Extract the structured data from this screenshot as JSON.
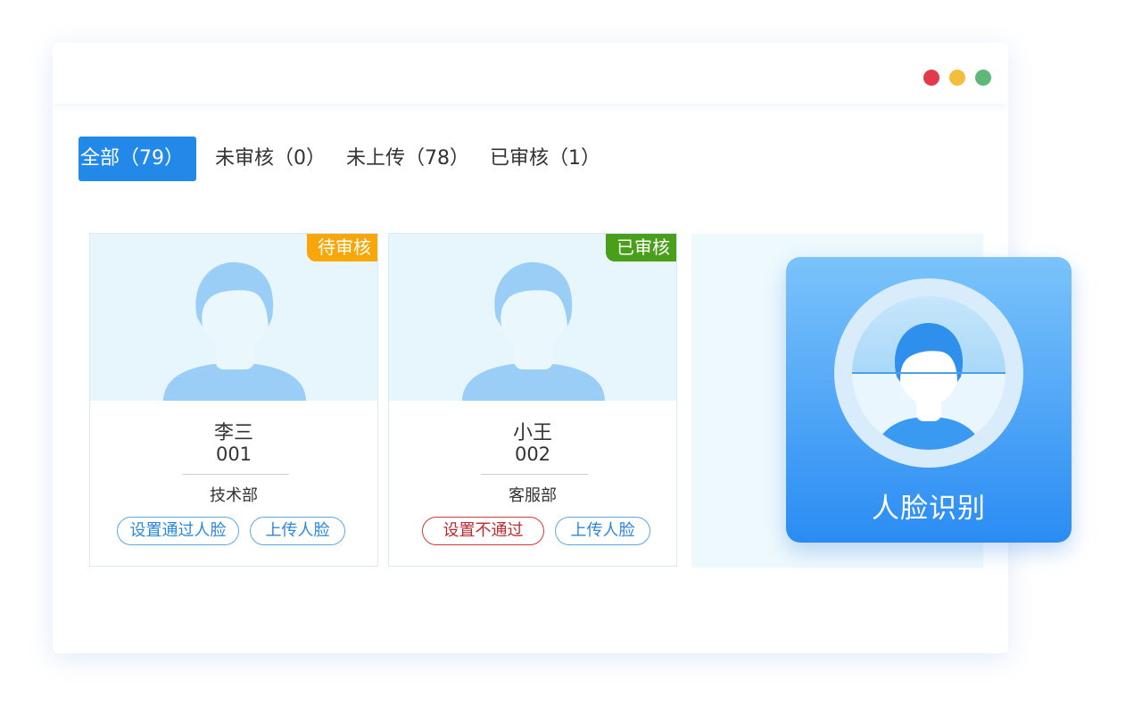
{
  "window": {
    "controls": [
      "close-dot",
      "minimize-dot",
      "maximize-dot"
    ],
    "control_colors": [
      "#e23a4c",
      "#f3be3b",
      "#5fb878"
    ]
  },
  "tabs": [
    {
      "label": "全部（79）",
      "active": true
    },
    {
      "label": "未审核（0）",
      "active": false
    },
    {
      "label": "未上传（78）",
      "active": false
    },
    {
      "label": "已审核（1）",
      "active": false
    }
  ],
  "cards": [
    {
      "badge": "待审核",
      "badge_color": "#f7a70a",
      "name": "李三",
      "number": "001",
      "department": "技术部",
      "buttons": [
        "设置通过人脸",
        "上传人脸"
      ]
    },
    {
      "badge": "已审核",
      "badge_color": "#4a9f1a",
      "name": "小王",
      "number": "002",
      "department": "客服部",
      "buttons": [
        "设置不通过",
        "上传人脸"
      ]
    }
  ],
  "face_recognition": {
    "label": "人脸识别",
    "icon": "face-scan-icon"
  },
  "colors": {
    "accent": "#2289e8",
    "pending": "#f7a70a",
    "approved": "#4a9f1a",
    "reject": "#c0282d"
  }
}
